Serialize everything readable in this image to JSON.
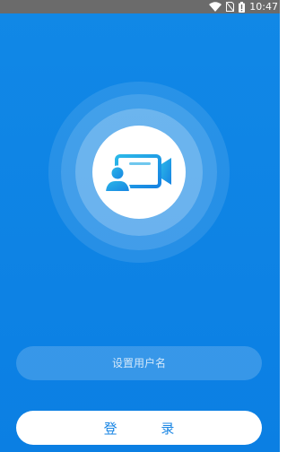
{
  "status_bar": {
    "time": "10:47",
    "icons": [
      "wifi-icon",
      "no-sim-icon",
      "battery-icon"
    ]
  },
  "logo": {
    "icon": "video-call-icon",
    "accent_color": "#1aa0e6"
  },
  "username": {
    "placeholder": "设置用户名",
    "value": ""
  },
  "login": {
    "label": "登 录"
  },
  "colors": {
    "background": "#0b7fe3",
    "status_bar": "#6b6b6b",
    "button_text": "#1a86e4"
  }
}
